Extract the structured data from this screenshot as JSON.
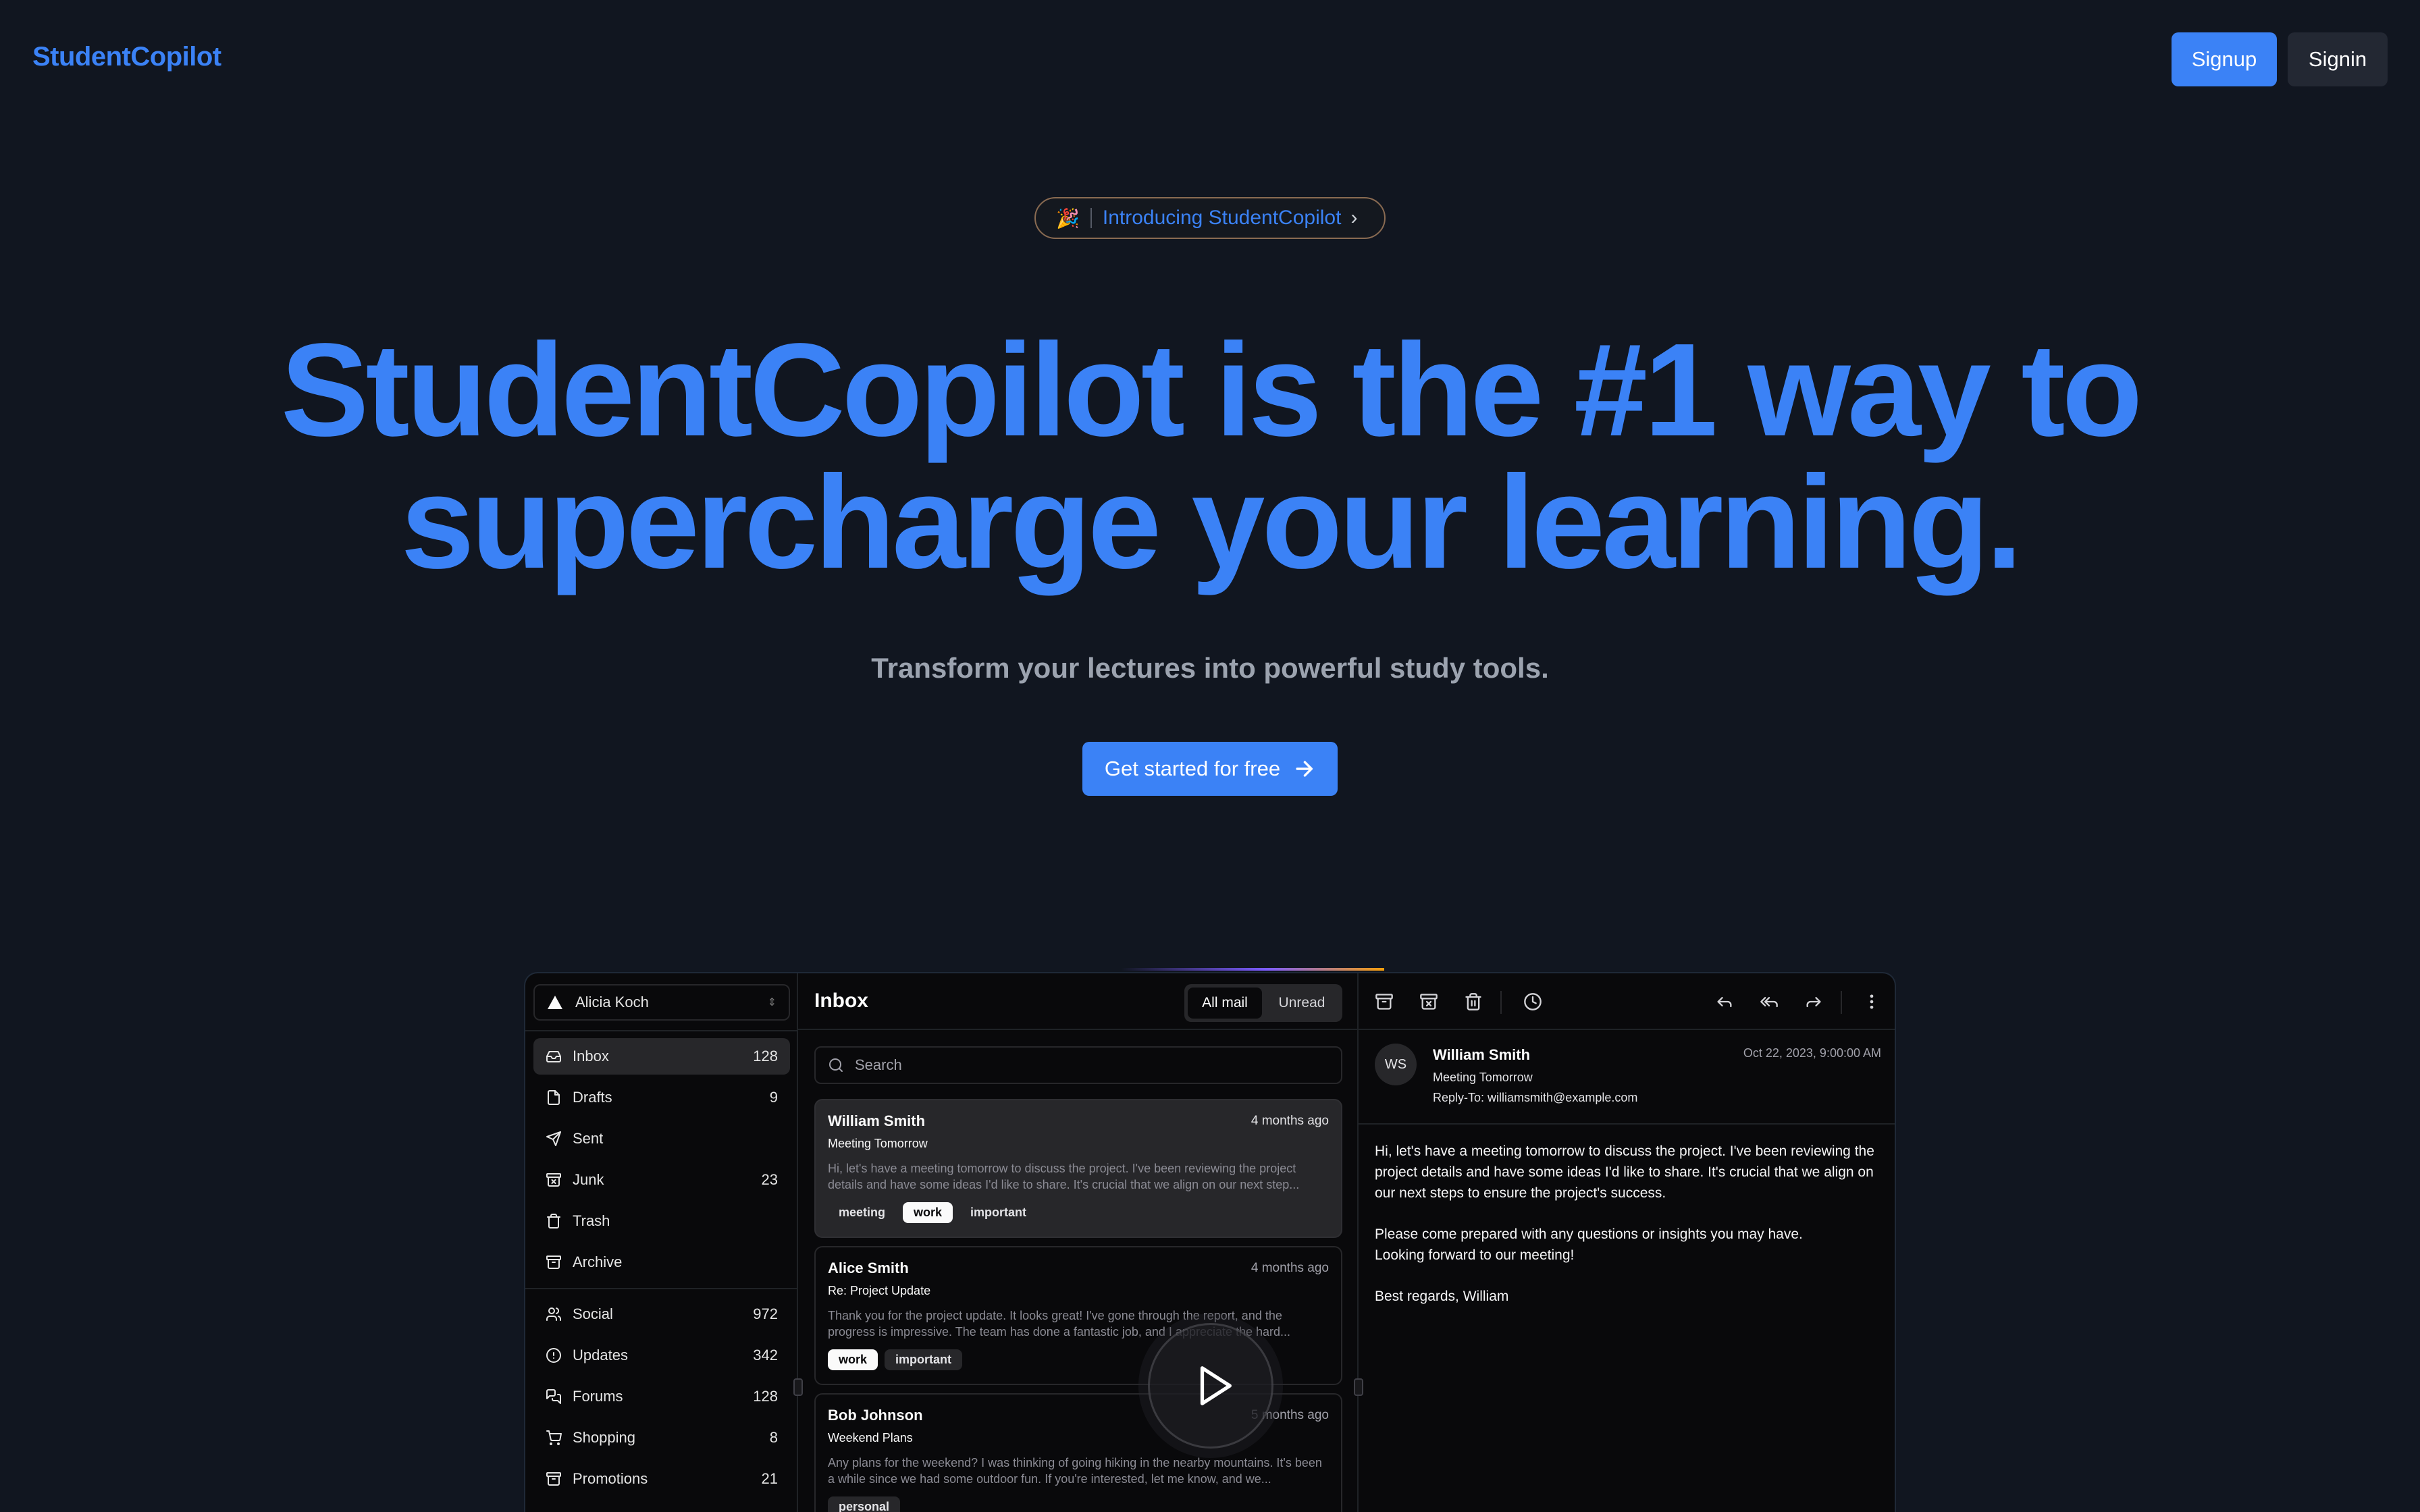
{
  "nav": {
    "logo": "StudentCopilot",
    "signup": "Signup",
    "signin": "Signin"
  },
  "hero": {
    "badge_emoji": "🎉",
    "badge_text": "Introducing StudentCopilot",
    "headline_line1": "StudentCopilot is the #1 way to",
    "headline_line2": "supercharge your learning.",
    "subheadline": "Transform your lectures into powerful study tools.",
    "cta": "Get started for free"
  },
  "app": {
    "account": "Alicia Koch",
    "sidebar_primary": [
      {
        "label": "Inbox",
        "count": "128",
        "icon": "inbox-icon"
      },
      {
        "label": "Drafts",
        "count": "9",
        "icon": "file-icon"
      },
      {
        "label": "Sent",
        "count": "",
        "icon": "send-icon"
      },
      {
        "label": "Junk",
        "count": "23",
        "icon": "archive-x-icon"
      },
      {
        "label": "Trash",
        "count": "",
        "icon": "trash-icon"
      },
      {
        "label": "Archive",
        "count": "",
        "icon": "archive-icon"
      }
    ],
    "sidebar_secondary": [
      {
        "label": "Social",
        "count": "972",
        "icon": "users-icon"
      },
      {
        "label": "Updates",
        "count": "342",
        "icon": "alert-circle-icon"
      },
      {
        "label": "Forums",
        "count": "128",
        "icon": "messages-icon"
      },
      {
        "label": "Shopping",
        "count": "8",
        "icon": "cart-icon"
      },
      {
        "label": "Promotions",
        "count": "21",
        "icon": "archive-icon"
      }
    ],
    "list": {
      "title": "Inbox",
      "tab_all": "All mail",
      "tab_unread": "Unread",
      "search_placeholder": "Search",
      "mails": [
        {
          "from": "William Smith",
          "time": "4 months ago",
          "subject": "Meeting Tomorrow",
          "preview": "Hi, let's have a meeting tomorrow to discuss the project. I've been reviewing the project details and have some ideas I'd like to share. It's crucial that we align on our next step...",
          "tags": [
            "meeting",
            "work",
            "important"
          ]
        },
        {
          "from": "Alice Smith",
          "time": "4 months ago",
          "subject": "Re: Project Update",
          "preview": "Thank you for the project update. It looks great! I've gone through the report, and the progress is impressive. The team has done a fantastic job, and I appreciate the hard...",
          "tags": [
            "work",
            "important"
          ]
        },
        {
          "from": "Bob Johnson",
          "time": "5 months ago",
          "subject": "Weekend Plans",
          "preview": "Any plans for the weekend? I was thinking of going hiking in the nearby mountains. It's been a while since we had some outdoor fun. If you're interested, let me know, and we...",
          "tags": [
            "personal"
          ]
        }
      ]
    },
    "detail": {
      "initials": "WS",
      "from": "William Smith",
      "subject": "Meeting Tomorrow",
      "reply_to": "Reply-To: williamsmith@example.com",
      "date": "Oct 22, 2023, 9:00:00 AM",
      "body_p1": "Hi, let's have a meeting tomorrow to discuss the project. I've been reviewing the project details and have some ideas I'd like to share. It's crucial that we align on our next steps to ensure the project's success.",
      "body_p2a": "Please come prepared with any questions or insights you may have.",
      "body_p2b": "Looking forward to our meeting!",
      "body_p3": "Best regards, William"
    }
  },
  "colors": {
    "background": "#111620",
    "accent": "#3b82f6",
    "app_background": "#09090b"
  }
}
